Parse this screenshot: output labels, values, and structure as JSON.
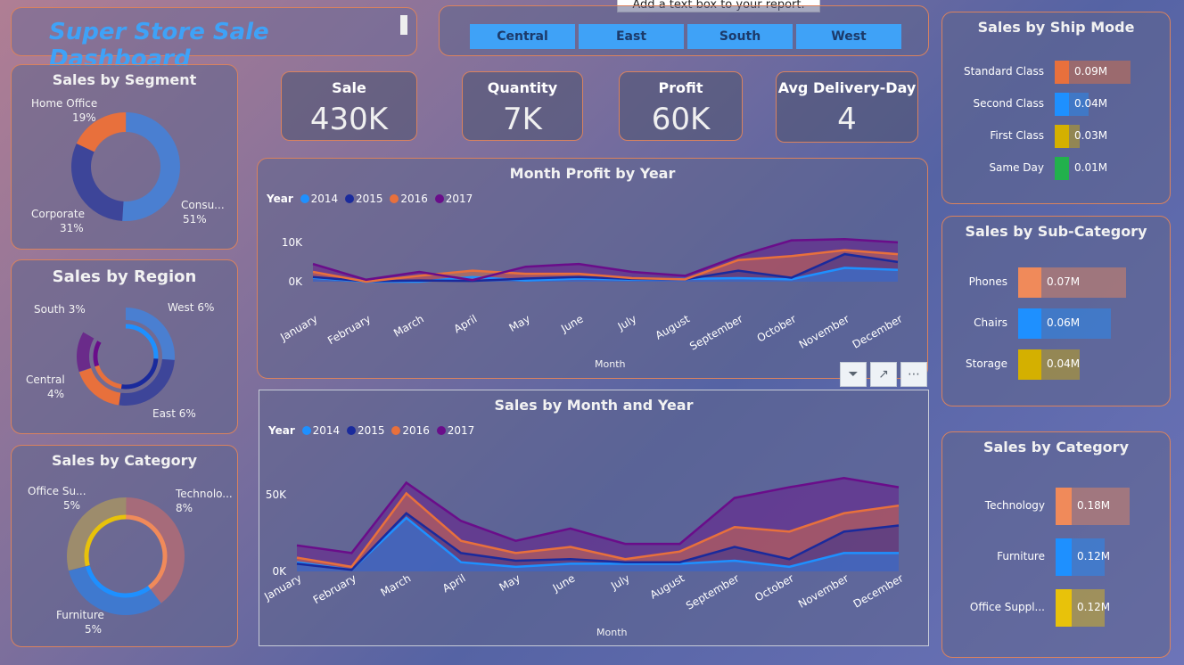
{
  "title": "Super Store Sale Dashboard",
  "tooltip": "Add a text box to your report.",
  "regions": [
    "Central",
    "East",
    "South",
    "West"
  ],
  "kpis": [
    {
      "label": "Sale",
      "value": "430K"
    },
    {
      "label": "Quantity",
      "value": "7K"
    },
    {
      "label": "Profit",
      "value": "60K"
    },
    {
      "label": "Avg Delivery-Day",
      "value": "4"
    }
  ],
  "segment": {
    "title": "Sales by Segment",
    "items": [
      {
        "name": "Home Office",
        "pct": "19%"
      },
      {
        "name": "Corporate",
        "pct": "31%"
      },
      {
        "name": "Consu...",
        "pct": "51%"
      }
    ]
  },
  "region": {
    "title": "Sales by Region",
    "items": [
      {
        "label": "South 3%"
      },
      {
        "label": "West 6%"
      },
      {
        "label": "Central"
      },
      {
        "label": "4%"
      },
      {
        "label": "East 6%"
      }
    ]
  },
  "category_donut": {
    "title": "Sales by Category",
    "items": [
      {
        "name": "Office Su...",
        "pct": "5%"
      },
      {
        "name": "Technolo...",
        "pct": "8%"
      },
      {
        "name": "Furniture",
        "pct": "5%"
      }
    ]
  },
  "ship_mode": {
    "title": "Sales by Ship Mode",
    "items": [
      {
        "name": "Standard Class",
        "value": "0.09M",
        "v": 0.09,
        "color": "#e8703c"
      },
      {
        "name": "Second Class",
        "value": "0.04M",
        "v": 0.04,
        "color": "#1e90ff"
      },
      {
        "name": "First Class",
        "value": "0.03M",
        "v": 0.03,
        "color": "#d4b000"
      },
      {
        "name": "Same Day",
        "value": "0.01M",
        "v": 0.01,
        "color": "#22b14c"
      }
    ]
  },
  "sub_category": {
    "title": "Sales by Sub-Category",
    "items": [
      {
        "name": "Phones",
        "value": "0.07M",
        "v": 0.07,
        "color": "#f08a5a"
      },
      {
        "name": "Chairs",
        "value": "0.06M",
        "v": 0.06,
        "color": "#1e90ff"
      },
      {
        "name": "Storage",
        "value": "0.04M",
        "v": 0.04,
        "color": "#d4b000"
      }
    ]
  },
  "category_bars": {
    "title": "Sales by Category",
    "items": [
      {
        "name": "Technology",
        "value": "0.18M",
        "v": 0.18,
        "color": "#f08a5a"
      },
      {
        "name": "Furniture",
        "value": "0.12M",
        "v": 0.12,
        "color": "#1e90ff"
      },
      {
        "name": "Office Suppl...",
        "value": "0.12M",
        "v": 0.12,
        "color": "#e8c20a"
      }
    ]
  },
  "legend": {
    "label": "Year",
    "years": [
      "2014",
      "2015",
      "2016",
      "2017"
    ],
    "colors": [
      "#1e90ff",
      "#1a2a9c",
      "#e8703c",
      "#6a0d8a"
    ]
  },
  "xlabel": "Month",
  "chart_data": [
    {
      "type": "area",
      "title": "Month Profit by Year",
      "xlabel": "Month",
      "ylabel": "",
      "categories": [
        "January",
        "February",
        "March",
        "April",
        "May",
        "June",
        "July",
        "August",
        "September",
        "October",
        "November",
        "December"
      ],
      "yticks": [
        "10K",
        "0K"
      ],
      "ylim": [
        0,
        12000
      ],
      "series": [
        {
          "name": "2014",
          "values": [
            1000,
            0,
            -200,
            1200,
            300,
            800,
            500,
            700,
            900,
            600,
            3500,
            3000
          ]
        },
        {
          "name": "2015",
          "values": [
            1200,
            100,
            300,
            200,
            800,
            1200,
            700,
            600,
            2800,
            1000,
            7000,
            5000
          ]
        },
        {
          "name": "2016",
          "values": [
            2500,
            0,
            1500,
            2800,
            2000,
            2000,
            900,
            600,
            5500,
            6500,
            8000,
            7000
          ]
        },
        {
          "name": "2017",
          "values": [
            4500,
            500,
            2500,
            400,
            3800,
            4500,
            2500,
            1500,
            6500,
            10500,
            10800,
            10000
          ]
        }
      ]
    },
    {
      "type": "area",
      "title": "Sales by Month and Year",
      "xlabel": "Month",
      "ylabel": "",
      "categories": [
        "January",
        "February",
        "March",
        "April",
        "May",
        "June",
        "July",
        "August",
        "September",
        "October",
        "November",
        "December"
      ],
      "yticks": [
        "50K",
        "0K"
      ],
      "ylim": [
        0,
        60000
      ],
      "series": [
        {
          "name": "2014",
          "values": [
            6000,
            1000,
            35000,
            6000,
            3000,
            5000,
            5000,
            5000,
            7000,
            3000,
            12000,
            12000
          ]
        },
        {
          "name": "2015",
          "values": [
            5000,
            1000,
            38000,
            12000,
            7000,
            8000,
            6000,
            6000,
            16000,
            8000,
            26000,
            30000
          ]
        },
        {
          "name": "2016",
          "values": [
            9000,
            3000,
            51000,
            20000,
            12000,
            16000,
            8000,
            13000,
            29000,
            26000,
            38000,
            43000
          ]
        },
        {
          "name": "2017",
          "values": [
            17000,
            12000,
            58000,
            33000,
            20000,
            28000,
            18000,
            18000,
            48000,
            55000,
            61000,
            55000
          ]
        }
      ]
    }
  ]
}
